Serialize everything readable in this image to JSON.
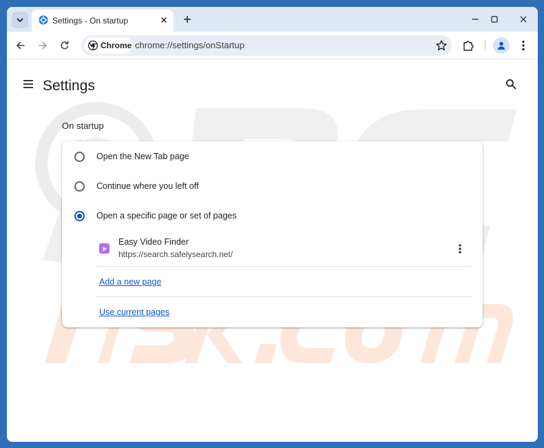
{
  "browser": {
    "tab_title": "Settings - On startup",
    "address_chip": "Chrome",
    "url": "chrome://settings/onStartup"
  },
  "settings": {
    "title": "Settings",
    "section_title": "On startup",
    "options": [
      {
        "label": "Open the New Tab page",
        "checked": false
      },
      {
        "label": "Continue where you left off",
        "checked": false
      },
      {
        "label": "Open a specific page or set of pages",
        "checked": true
      }
    ],
    "startup_pages": [
      {
        "name": "Easy Video Finder",
        "url": "https://search.safelysearch.net/"
      }
    ],
    "add_new_page": "Add a new page",
    "use_current_pages": "Use current pages"
  },
  "watermark": {
    "text_top": "PC",
    "text_bottom": "risk.com"
  },
  "colors": {
    "frame": "#2f6fb8",
    "tabstrip": "#dfe7f4",
    "accent": "#0b57d0",
    "extension_icon": "#b46ef2",
    "watermark_gray": "#e9e9e9",
    "watermark_orange": "#fde7db"
  },
  "icons": {
    "tab_search": "chevron-down-icon",
    "tab_favicon": "gear-icon",
    "back": "arrow-left-icon",
    "forward": "arrow-right-icon",
    "reload": "reload-icon",
    "bookmark": "star-icon",
    "extensions": "puzzle-icon",
    "profile": "person-icon",
    "menu": "kebab-icon",
    "settings_menu": "hamburger-icon",
    "settings_search": "search-icon"
  }
}
